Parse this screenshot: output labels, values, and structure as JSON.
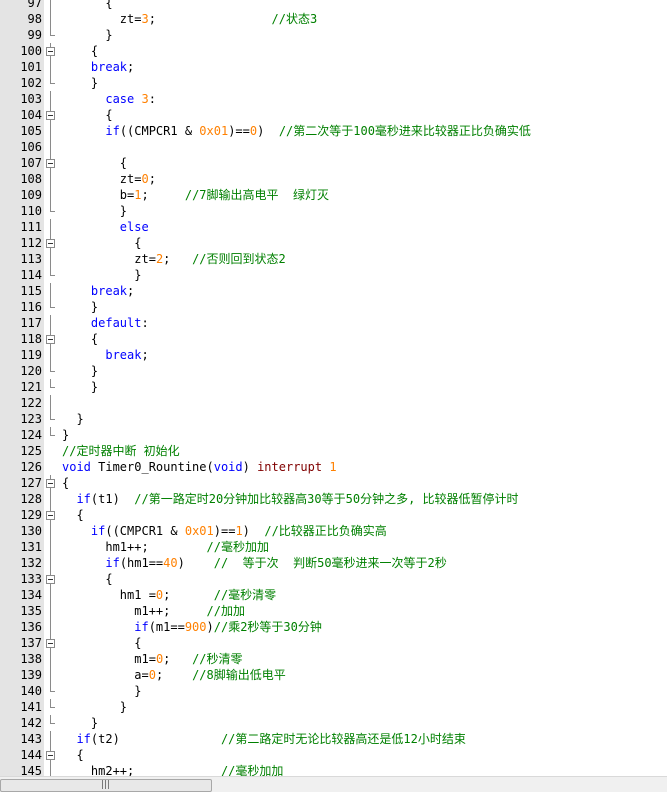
{
  "editor": {
    "lines": [
      {
        "n": "97",
        "fold": "line",
        "indent": "      ",
        "tokens": [
          {
            "t": "{",
            "c": ""
          }
        ]
      },
      {
        "n": "98",
        "fold": "line",
        "indent": "        ",
        "tokens": [
          {
            "t": "zt=",
            "c": ""
          },
          {
            "t": "3",
            "c": "num"
          },
          {
            "t": ";                ",
            "c": ""
          },
          {
            "t": "//状态3",
            "c": "cm"
          }
        ]
      },
      {
        "n": "99",
        "fold": "end",
        "indent": "      ",
        "tokens": [
          {
            "t": "}",
            "c": ""
          }
        ]
      },
      {
        "n": "100",
        "fold": "box",
        "indent": "    ",
        "tokens": [
          {
            "t": "{",
            "c": ""
          }
        ]
      },
      {
        "n": "101",
        "fold": "line",
        "indent": "    ",
        "tokens": [
          {
            "t": "break",
            "c": "kw"
          },
          {
            "t": ";",
            "c": ""
          }
        ]
      },
      {
        "n": "102",
        "fold": "end",
        "indent": "    ",
        "tokens": [
          {
            "t": "}",
            "c": ""
          }
        ]
      },
      {
        "n": "103",
        "fold": "line",
        "indent": "      ",
        "tokens": [
          {
            "t": "case ",
            "c": "kw"
          },
          {
            "t": "3",
            "c": "num"
          },
          {
            "t": ":",
            "c": ""
          }
        ]
      },
      {
        "n": "104",
        "fold": "box",
        "indent": "      ",
        "tokens": [
          {
            "t": "{",
            "c": ""
          }
        ]
      },
      {
        "n": "105",
        "fold": "line",
        "indent": "      ",
        "tokens": [
          {
            "t": "if",
            "c": "kw"
          },
          {
            "t": "((CMPCR1 & ",
            "c": ""
          },
          {
            "t": "0x01",
            "c": "num"
          },
          {
            "t": ")==",
            "c": ""
          },
          {
            "t": "0",
            "c": "num"
          },
          {
            "t": ")  ",
            "c": ""
          },
          {
            "t": "//第二次等于100毫秒进来比较器正比负确实低",
            "c": "cm"
          }
        ]
      },
      {
        "n": "106",
        "fold": "line",
        "indent": "",
        "tokens": []
      },
      {
        "n": "107",
        "fold": "box",
        "indent": "        ",
        "tokens": [
          {
            "t": "{",
            "c": ""
          }
        ]
      },
      {
        "n": "108",
        "fold": "line",
        "indent": "        ",
        "tokens": [
          {
            "t": "zt=",
            "c": ""
          },
          {
            "t": "0",
            "c": "num"
          },
          {
            "t": ";",
            "c": ""
          }
        ]
      },
      {
        "n": "109",
        "fold": "line",
        "indent": "        ",
        "tokens": [
          {
            "t": "b=",
            "c": ""
          },
          {
            "t": "1",
            "c": "num"
          },
          {
            "t": ";     ",
            "c": ""
          },
          {
            "t": "//7脚输出高电平  绿灯灭",
            "c": "cm"
          }
        ]
      },
      {
        "n": "110",
        "fold": "end",
        "indent": "        ",
        "tokens": [
          {
            "t": "}",
            "c": ""
          }
        ]
      },
      {
        "n": "111",
        "fold": "line",
        "indent": "        ",
        "tokens": [
          {
            "t": "else",
            "c": "kw"
          }
        ]
      },
      {
        "n": "112",
        "fold": "box",
        "indent": "          ",
        "tokens": [
          {
            "t": "{",
            "c": ""
          }
        ]
      },
      {
        "n": "113",
        "fold": "line",
        "indent": "          ",
        "tokens": [
          {
            "t": "zt=",
            "c": ""
          },
          {
            "t": "2",
            "c": "num"
          },
          {
            "t": ";   ",
            "c": ""
          },
          {
            "t": "//否则回到状态2",
            "c": "cm"
          }
        ]
      },
      {
        "n": "114",
        "fold": "end",
        "indent": "          ",
        "tokens": [
          {
            "t": "}",
            "c": ""
          }
        ]
      },
      {
        "n": "115",
        "fold": "line",
        "indent": "    ",
        "tokens": [
          {
            "t": "break",
            "c": "kw"
          },
          {
            "t": ";",
            "c": ""
          }
        ]
      },
      {
        "n": "116",
        "fold": "end",
        "indent": "    ",
        "tokens": [
          {
            "t": "}",
            "c": ""
          }
        ]
      },
      {
        "n": "117",
        "fold": "line",
        "indent": "    ",
        "tokens": [
          {
            "t": "default",
            "c": "kw"
          },
          {
            "t": ":",
            "c": ""
          }
        ]
      },
      {
        "n": "118",
        "fold": "box",
        "indent": "    ",
        "tokens": [
          {
            "t": "{",
            "c": ""
          }
        ]
      },
      {
        "n": "119",
        "fold": "line",
        "indent": "      ",
        "tokens": [
          {
            "t": "break",
            "c": "kw"
          },
          {
            "t": ";",
            "c": ""
          }
        ]
      },
      {
        "n": "120",
        "fold": "end",
        "indent": "    ",
        "tokens": [
          {
            "t": "}",
            "c": ""
          }
        ]
      },
      {
        "n": "121",
        "fold": "end",
        "indent": "    ",
        "tokens": [
          {
            "t": "}",
            "c": ""
          }
        ]
      },
      {
        "n": "122",
        "fold": "line",
        "indent": "",
        "tokens": []
      },
      {
        "n": "123",
        "fold": "end",
        "indent": "  ",
        "tokens": [
          {
            "t": "}",
            "c": ""
          }
        ]
      },
      {
        "n": "124",
        "fold": "end",
        "indent": "",
        "tokens": [
          {
            "t": "}",
            "c": ""
          }
        ]
      },
      {
        "n": "125",
        "fold": "none",
        "indent": "",
        "tokens": [
          {
            "t": "//定时器中断 初始化",
            "c": "cm"
          }
        ]
      },
      {
        "n": "126",
        "fold": "none",
        "indent": "",
        "tokens": [
          {
            "t": "void ",
            "c": "kw"
          },
          {
            "t": "Timer0_Rountine(",
            "c": ""
          },
          {
            "t": "void",
            "c": "kw"
          },
          {
            "t": ") ",
            "c": ""
          },
          {
            "t": "interrupt ",
            "c": "kw2"
          },
          {
            "t": "1",
            "c": "num"
          }
        ]
      },
      {
        "n": "127",
        "fold": "box",
        "indent": "",
        "tokens": [
          {
            "t": "{",
            "c": ""
          }
        ]
      },
      {
        "n": "128",
        "fold": "line",
        "indent": "  ",
        "tokens": [
          {
            "t": "if",
            "c": "kw"
          },
          {
            "t": "(t1)  ",
            "c": ""
          },
          {
            "t": "//第一路定时20分钟加比较器高30等于50分钟之多, 比较器低暂停计时",
            "c": "cm"
          }
        ]
      },
      {
        "n": "129",
        "fold": "box",
        "indent": "  ",
        "tokens": [
          {
            "t": "{",
            "c": ""
          }
        ]
      },
      {
        "n": "130",
        "fold": "line",
        "indent": "    ",
        "tokens": [
          {
            "t": "if",
            "c": "kw"
          },
          {
            "t": "((CMPCR1 & ",
            "c": ""
          },
          {
            "t": "0x01",
            "c": "num"
          },
          {
            "t": ")==",
            "c": ""
          },
          {
            "t": "1",
            "c": "num"
          },
          {
            "t": ")  ",
            "c": ""
          },
          {
            "t": "//比较器正比负确实高",
            "c": "cm"
          }
        ]
      },
      {
        "n": "131",
        "fold": "line",
        "indent": "      ",
        "tokens": [
          {
            "t": "hm1++;        ",
            "c": ""
          },
          {
            "t": "//毫秒加加",
            "c": "cm"
          }
        ]
      },
      {
        "n": "132",
        "fold": "line",
        "indent": "      ",
        "tokens": [
          {
            "t": "if",
            "c": "kw"
          },
          {
            "t": "(hm1==",
            "c": ""
          },
          {
            "t": "40",
            "c": "num"
          },
          {
            "t": ")    ",
            "c": ""
          },
          {
            "t": "//  等于次  判断50毫秒进来一次等于2秒",
            "c": "cm"
          }
        ]
      },
      {
        "n": "133",
        "fold": "box",
        "indent": "      ",
        "tokens": [
          {
            "t": "{",
            "c": ""
          }
        ]
      },
      {
        "n": "134",
        "fold": "line",
        "indent": "        ",
        "tokens": [
          {
            "t": "hm1 =",
            "c": ""
          },
          {
            "t": "0",
            "c": "num"
          },
          {
            "t": ";      ",
            "c": ""
          },
          {
            "t": "//毫秒清零",
            "c": "cm"
          }
        ]
      },
      {
        "n": "135",
        "fold": "line",
        "indent": "          ",
        "tokens": [
          {
            "t": "m1++;     ",
            "c": ""
          },
          {
            "t": "//加加",
            "c": "cm"
          }
        ]
      },
      {
        "n": "136",
        "fold": "line",
        "indent": "          ",
        "tokens": [
          {
            "t": "if",
            "c": "kw"
          },
          {
            "t": "(m1==",
            "c": ""
          },
          {
            "t": "900",
            "c": "num"
          },
          {
            "t": ")",
            "c": ""
          },
          {
            "t": "//乘2秒等于30分钟",
            "c": "cm"
          }
        ]
      },
      {
        "n": "137",
        "fold": "box",
        "indent": "          ",
        "tokens": [
          {
            "t": "{",
            "c": ""
          }
        ]
      },
      {
        "n": "138",
        "fold": "line",
        "indent": "          ",
        "tokens": [
          {
            "t": "m1=",
            "c": ""
          },
          {
            "t": "0",
            "c": "num"
          },
          {
            "t": ";   ",
            "c": ""
          },
          {
            "t": "//秒清零",
            "c": "cm"
          }
        ]
      },
      {
        "n": "139",
        "fold": "line",
        "indent": "          ",
        "tokens": [
          {
            "t": "a=",
            "c": ""
          },
          {
            "t": "0",
            "c": "num"
          },
          {
            "t": ";    ",
            "c": ""
          },
          {
            "t": "//8脚输出低电平",
            "c": "cm"
          }
        ]
      },
      {
        "n": "140",
        "fold": "end",
        "indent": "          ",
        "tokens": [
          {
            "t": "}",
            "c": ""
          }
        ]
      },
      {
        "n": "141",
        "fold": "end",
        "indent": "        ",
        "tokens": [
          {
            "t": "}",
            "c": ""
          }
        ]
      },
      {
        "n": "142",
        "fold": "end",
        "indent": "    ",
        "tokens": [
          {
            "t": "}",
            "c": ""
          }
        ]
      },
      {
        "n": "143",
        "fold": "line",
        "indent": "  ",
        "tokens": [
          {
            "t": "if",
            "c": "kw"
          },
          {
            "t": "(t2)              ",
            "c": ""
          },
          {
            "t": "//第二路定时无论比较器高还是低12小时结束",
            "c": "cm"
          }
        ]
      },
      {
        "n": "144",
        "fold": "box",
        "indent": "  ",
        "tokens": [
          {
            "t": "{",
            "c": ""
          }
        ]
      },
      {
        "n": "145",
        "fold": "line",
        "indent": "    ",
        "tokens": [
          {
            "t": "hm2++;            ",
            "c": ""
          },
          {
            "t": "//毫秒加加",
            "c": "cm"
          }
        ]
      }
    ]
  },
  "scrollbar": {
    "grip": "|||"
  }
}
